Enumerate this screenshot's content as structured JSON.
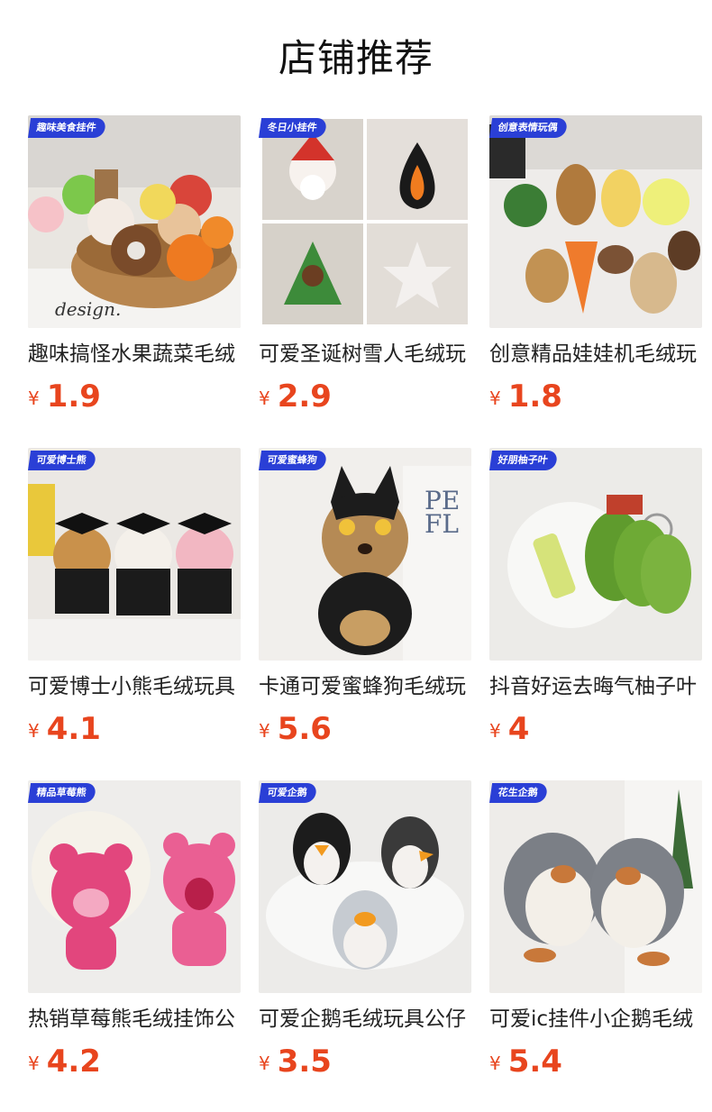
{
  "header": {
    "title": "店铺推荐"
  },
  "colors": {
    "price": "#e8451e",
    "tag_bg": "#2a3fd6"
  },
  "currency": "¥",
  "products": [
    {
      "tag": "趣味美食挂件",
      "name": "趣味搞怪水果蔬菜毛绒",
      "price": "1.9",
      "scene": "food-basket"
    },
    {
      "tag": "冬日小挂件",
      "name": "可爱圣诞树雪人毛绒玩",
      "price": "2.9",
      "scene": "christmas"
    },
    {
      "tag": "创意表情玩偶",
      "name": "创意精品娃娃机毛绒玩",
      "price": "1.8",
      "scene": "veggies"
    },
    {
      "tag": "可爱博士熊",
      "name": "可爱博士小熊毛绒玩具",
      "price": "4.1",
      "scene": "bears"
    },
    {
      "tag": "可爱蜜蜂狗",
      "name": "卡通可爱蜜蜂狗毛绒玩",
      "price": "5.6",
      "scene": "dog"
    },
    {
      "tag": "好朋柚子叶",
      "name": "抖音好运去晦气柚子叶",
      "price": "4",
      "scene": "leaf"
    },
    {
      "tag": "精品草莓熊",
      "name": "热销草莓熊毛绒挂饰公",
      "price": "4.2",
      "scene": "strawberry-bear"
    },
    {
      "tag": "可爱企鹅",
      "name": "可爱企鹅毛绒玩具公仔",
      "price": "3.5",
      "scene": "penguins"
    },
    {
      "tag": "花生企鹅",
      "name": "可爱ic挂件小企鹅毛绒",
      "price": "5.4",
      "scene": "peanut-penguins"
    }
  ]
}
